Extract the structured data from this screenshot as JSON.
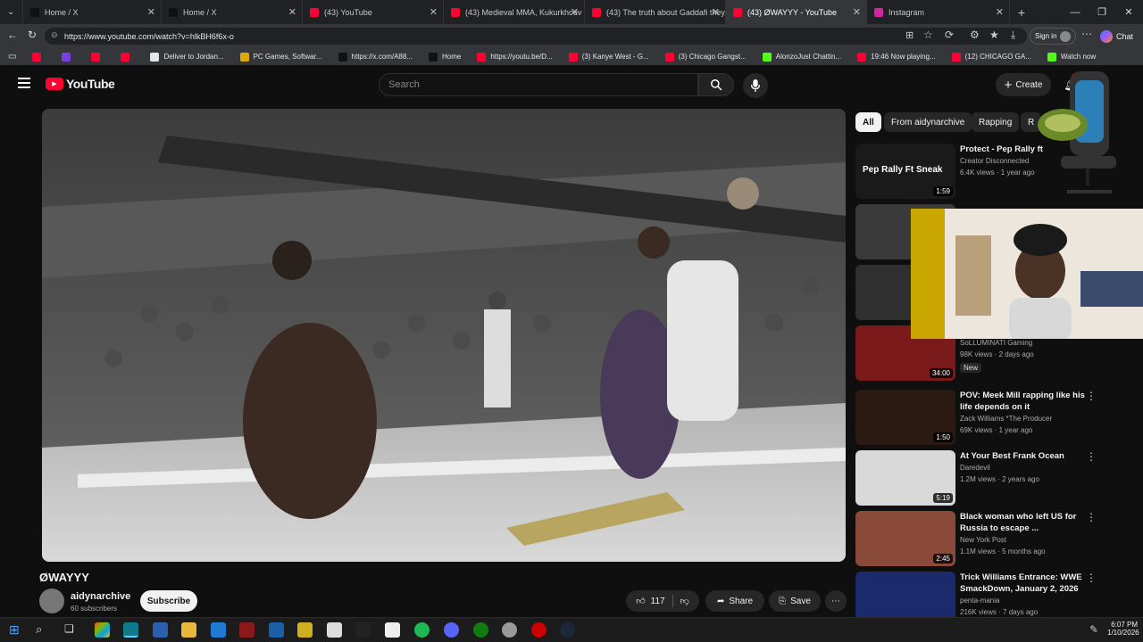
{
  "tabs": [
    {
      "label": "Home / X",
      "fav": "#111"
    },
    {
      "label": "Home / X",
      "fav": "#111"
    },
    {
      "label": "(43) YouTube",
      "fav": "#ff0033"
    },
    {
      "label": "(43) Medieval MMA, Kukurkhoev",
      "fav": "#ff0033"
    },
    {
      "label": "(43) The truth about Gaddafi they",
      "fav": "#ff0033"
    },
    {
      "label": "(43) ØWAYYY - YouTube",
      "fav": "#ff0033"
    },
    {
      "label": "Instagram",
      "fav": "#d6249f"
    }
  ],
  "address": {
    "url": "https://www.youtube.com/watch?v=hlkBH6f6x-o",
    "signin": "Sign in",
    "chat": "Chat"
  },
  "bookmarks": [
    {
      "label": "",
      "color": "#ff0033"
    },
    {
      "label": "",
      "color": "#7b3fe4"
    },
    {
      "label": "",
      "color": "#ff0033"
    },
    {
      "label": "",
      "color": "#ff0033"
    },
    {
      "label": "Deliver to Jordan...",
      "color": "#e6e6e6"
    },
    {
      "label": "PC Games, Softwar...",
      "color": "#e0a800"
    },
    {
      "label": "https://x.com/A88...",
      "color": "#111"
    },
    {
      "label": "Home",
      "color": "#111"
    },
    {
      "label": "https://youtu.be/D...",
      "color": "#ff0033"
    },
    {
      "label": "(3) Kanye West - G...",
      "color": "#ff0033"
    },
    {
      "label": "(3) Chicago Gangst...",
      "color": "#ff0033"
    },
    {
      "label": "AlonzoJust Chattin...",
      "color": "#53fc18"
    },
    {
      "label": "19:46 Now playing...",
      "color": "#ff0033"
    },
    {
      "label": "(12) CHICAGO GA...",
      "color": "#ff0033"
    },
    {
      "label": "Watch now",
      "color": "#53fc18"
    }
  ],
  "yt": {
    "logo": "YouTube",
    "search_placeholder": "Search",
    "create": "Create",
    "notif": "9+",
    "video_title": "ØWAYYY",
    "channel": "aidynarchive",
    "subs": "60 subscribers",
    "subscribe": "Subscribe",
    "likes": "117",
    "share": "Share",
    "save": "Save"
  },
  "chips": [
    "All",
    "From aidynarchive",
    "Rapping",
    "R"
  ],
  "recs": [
    {
      "title": "Protect - Pep Rally ft",
      "channel": "Creator Disconnected",
      "meta": "6.4K views · 1 year ago",
      "dur": "1:59",
      "thumb": "#1a1a1a",
      "thumbText": "Pep Rally Ft Sneak"
    },
    {
      "title": "",
      "channel": "",
      "meta": "",
      "dur": "",
      "thumb": "#3a3a3a",
      "thumbText": ""
    },
    {
      "title": "",
      "channel": "",
      "meta": "",
      "dur": "",
      "thumb": "#2f2f2f",
      "thumbText": ""
    },
    {
      "title": "HER ❤️ - (Back Retired)",
      "channel": "SoLLUMINATI Gaming",
      "meta": "98K views · 2 days ago",
      "badge": "New",
      "dur": "34:00",
      "thumb": "#7a1a1a",
      "thumbText": ""
    },
    {
      "title": "POV: Meek Mill rapping like his life depends on it",
      "channel": "Zack Williams *The Producer",
      "meta": "69K views · 1 year ago",
      "dur": "1:50",
      "thumb": "#2a1a12",
      "thumbText": ""
    },
    {
      "title": "At Your Best Frank Ocean",
      "channel": "Daredevil",
      "meta": "1.2M views · 2 years ago",
      "dur": "5:19",
      "thumb": "#d9d9d9",
      "thumbText": ""
    },
    {
      "title": "Black woman who left US for Russia to escape ...",
      "channel": "New York Post",
      "meta": "1.1M views · 5 months ago",
      "dur": "2:45",
      "thumb": "#8a4a3a",
      "thumbText": ""
    },
    {
      "title": "Trick Williams Entrance: WWE SmackDown, January 2, 2026",
      "channel": "penta-mania",
      "meta": "216K views · 7 days ago",
      "dur": "",
      "thumb": "#1a2a6a",
      "thumbText": ""
    }
  ],
  "taskbar": {
    "time": "6:07 PM",
    "date": "1/10/2026"
  },
  "colors": {
    "accent": "#ff0033",
    "bg": "#0f0f0f"
  }
}
